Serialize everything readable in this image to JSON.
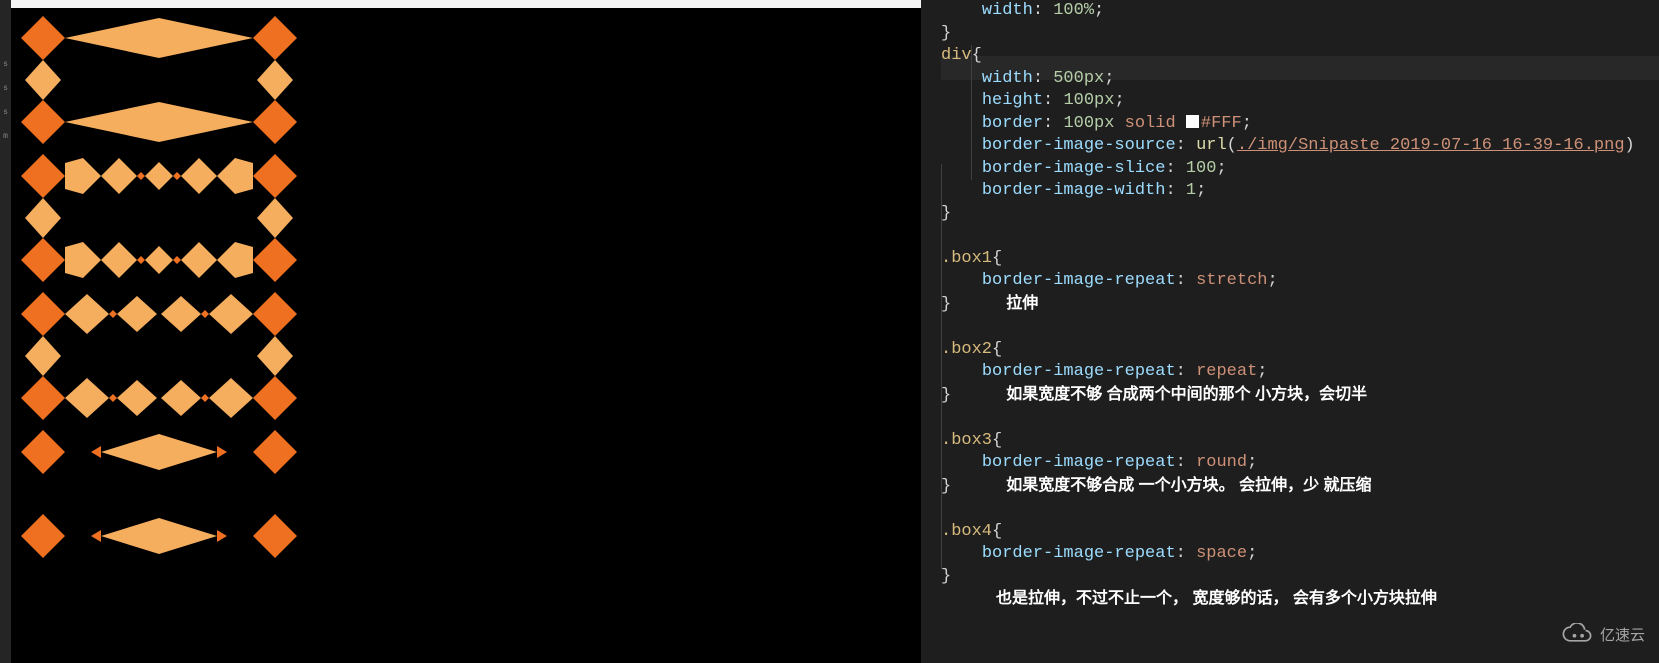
{
  "gutter": {
    "marks": [
      "s",
      "s",
      "s",
      "m"
    ]
  },
  "code": {
    "line_top_prop": "width",
    "line_top_val": "100%",
    "div_sel": "div",
    "div": {
      "p1": "width",
      "v1": "500px",
      "p2": "height",
      "v2": "100px",
      "p3": "border",
      "v3a": "100px",
      "v3b": "solid",
      "v3c": "#FFF",
      "p4": "border-image-source",
      "v4func": "url",
      "v4arg": "./img/Snipaste_2019-07-16_16-39-16.png",
      "p5": "border-image-slice",
      "v5": "100",
      "p6": "border-image-width",
      "v6": "1"
    },
    "box1": {
      "sel": ".box1",
      "prop": "border-image-repeat",
      "val": "stretch",
      "note": "拉伸"
    },
    "box2": {
      "sel": ".box2",
      "prop": "border-image-repeat",
      "val": "repeat",
      "note": "如果宽度不够 合成两个中间的那个 小方块，会切半"
    },
    "box3": {
      "sel": ".box3",
      "prop": "border-image-repeat",
      "val": "round",
      "note": "如果宽度不够合成 一个小方块。 会拉伸，少 就压缩"
    },
    "box4": {
      "sel": ".box4",
      "prop": "border-image-repeat",
      "val": "space",
      "note": "也是拉伸，不过不止一个， 宽度够的话， 会有多个小方块拉伸"
    }
  },
  "watermark": {
    "text": "亿速云"
  }
}
